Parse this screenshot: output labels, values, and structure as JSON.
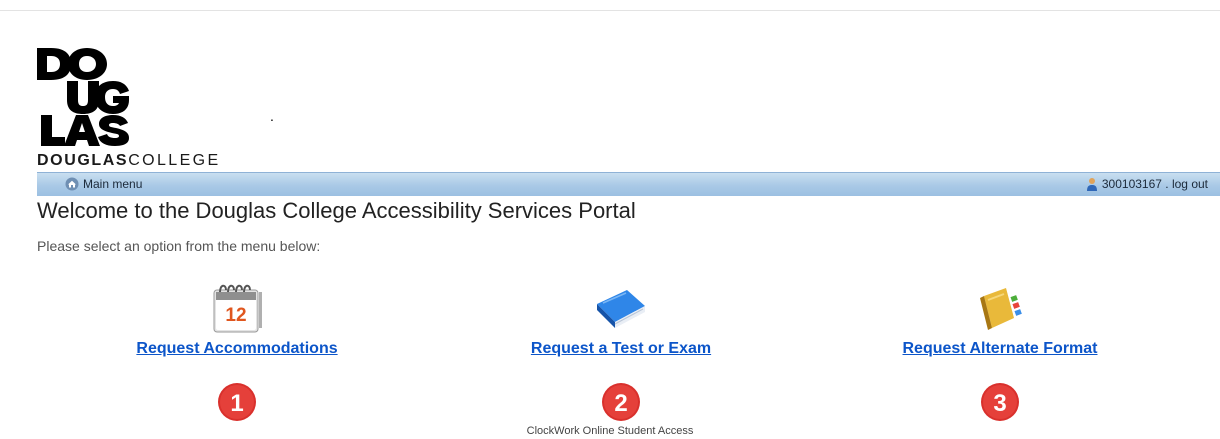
{
  "header": {
    "logo_wordmark_bold": "DOUGLAS",
    "logo_wordmark_light": "COLLEGE",
    "logo_dot": "."
  },
  "navbar": {
    "main_menu_label": "Main menu",
    "user_id": "300103167",
    "separator": " . ",
    "logout_label": "log out"
  },
  "page": {
    "title": "Welcome to the Douglas College Accessibility Services Portal",
    "instruction": "Please select an option from the menu below:"
  },
  "options": [
    {
      "label": "Request Accommodations",
      "icon": "calendar-icon",
      "calendar_number": "12",
      "step": "1"
    },
    {
      "label": "Request a Test or Exam",
      "icon": "book-icon",
      "step": "2"
    },
    {
      "label": "Request Alternate Format",
      "icon": "address-book-icon",
      "step": "3"
    }
  ],
  "footer": {
    "text": "ClockWork Online Student Access"
  },
  "colors": {
    "link": "#0c55c9",
    "navbar": "#a9c9e6",
    "badge": "#d9302c",
    "book": "#1f6fd1",
    "address_book": "#d9a92b"
  }
}
